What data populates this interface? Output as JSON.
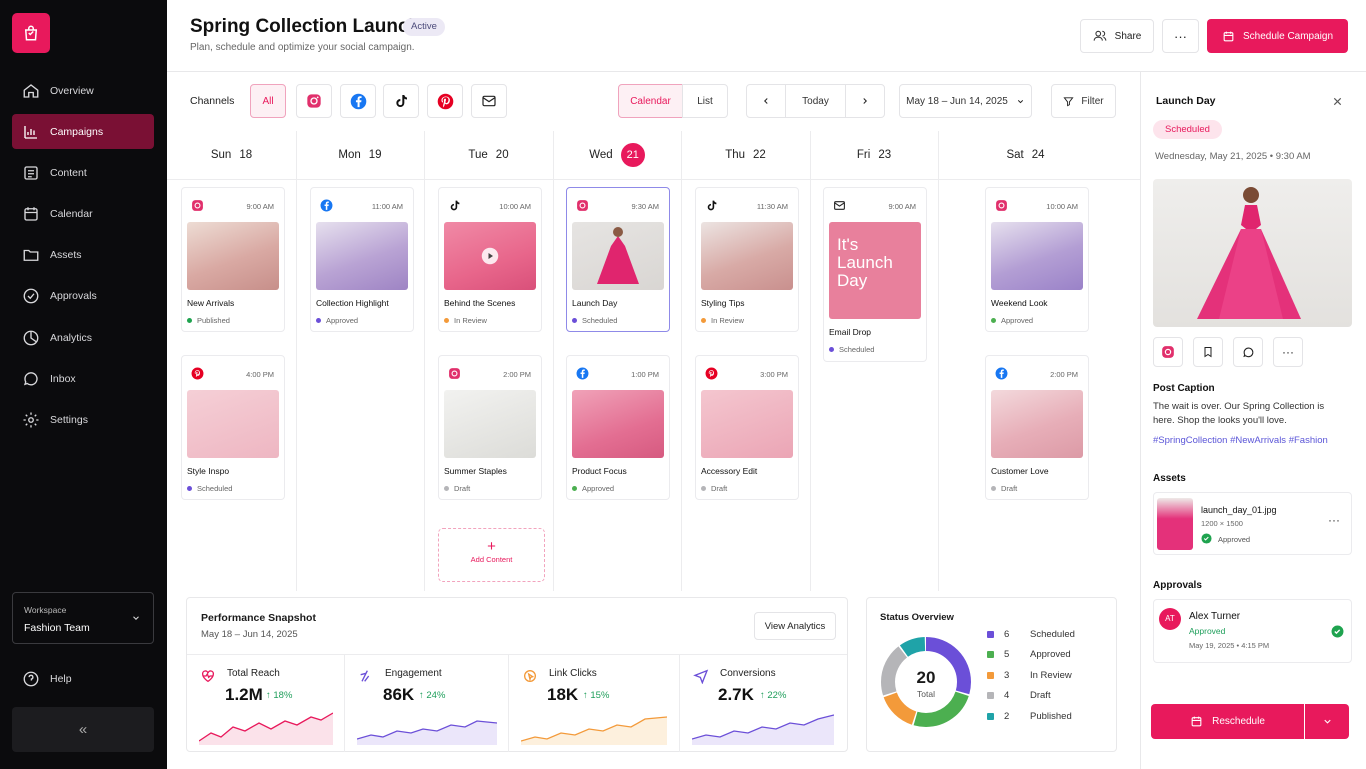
{
  "sidebar": {
    "items": [
      {
        "label": "Overview"
      },
      {
        "label": "Campaigns"
      },
      {
        "label": "Content"
      },
      {
        "label": "Calendar"
      },
      {
        "label": "Assets"
      },
      {
        "label": "Approvals"
      },
      {
        "label": "Analytics"
      },
      {
        "label": "Inbox"
      },
      {
        "label": "Settings"
      }
    ],
    "workspace_label": "Workspace",
    "workspace_name": "Fashion Team",
    "help": "Help",
    "collapse": "«"
  },
  "header": {
    "title": "Spring Collection Launch",
    "status": "Active",
    "subtitle": "Plan, schedule and optimize your social campaign.",
    "share": "Share",
    "more": "···",
    "schedule": "Schedule Campaign"
  },
  "toolbar": {
    "channels_label": "Channels",
    "all": "All",
    "calendar": "Calendar",
    "list": "List",
    "today": "Today",
    "range": "May 18 – Jun 14, 2025",
    "filter": "Filter"
  },
  "days": [
    {
      "name": "Sun",
      "num": "18"
    },
    {
      "name": "Mon",
      "num": "19"
    },
    {
      "name": "Tue",
      "num": "20"
    },
    {
      "name": "Wed",
      "num": "21"
    },
    {
      "name": "Thu",
      "num": "22"
    },
    {
      "name": "Fri",
      "num": "23"
    },
    {
      "name": "Sat",
      "num": "24"
    }
  ],
  "cards": [
    {
      "time": "9:00 AM",
      "name": "New Arrivals",
      "status": "Published"
    },
    {
      "time": "11:00 AM",
      "name": "Collection Highlight",
      "status": "Approved"
    },
    {
      "time": "10:00 AM",
      "name": "Behind the Scenes",
      "status": "In Review"
    },
    {
      "time": "9:30 AM",
      "name": "Launch Day",
      "status": "Scheduled"
    },
    {
      "time": "11:30 AM",
      "name": "Styling Tips",
      "status": "In Review"
    },
    {
      "time": "9:00 AM",
      "name": "Email Drop",
      "status": "Scheduled",
      "overlay": "It's Launch Day"
    },
    {
      "time": "10:00 AM",
      "name": "Weekend Look",
      "status": "Approved"
    },
    {
      "time": "4:00 PM",
      "name": "Style Inspo",
      "status": "Scheduled"
    },
    {
      "time": "2:00 PM",
      "name": "Summer Staples",
      "status": "Draft"
    },
    {
      "time": "1:00 PM",
      "name": "Product Focus",
      "status": "Approved"
    },
    {
      "time": "3:00 PM",
      "name": "Accessory Edit",
      "status": "Draft"
    },
    {
      "time": "2:00 PM",
      "name": "Customer Love",
      "status": "Draft"
    }
  ],
  "add_content": "Add Content",
  "performance": {
    "title": "Performance Snapshot",
    "range": "May 18 – Jun 14, 2025",
    "view": "View Analytics",
    "kpis": [
      {
        "label": "Total Reach",
        "value": "1.2M",
        "change": "↑ 18%"
      },
      {
        "label": "Engagement",
        "value": "86K",
        "change": "↑ 24%"
      },
      {
        "label": "Link Clicks",
        "value": "18K",
        "change": "↑ 15%"
      },
      {
        "label": "Conversions",
        "value": "2.7K",
        "change": "↑ 22%"
      }
    ]
  },
  "status_overview": {
    "title": "Status Overview",
    "total": "20",
    "total_label": "Total",
    "rows": [
      {
        "count": "6",
        "label": "Scheduled",
        "color": "#6b4fd8"
      },
      {
        "count": "5",
        "label": "Approved",
        "color": "#4caf50"
      },
      {
        "count": "3",
        "label": "In Review",
        "color": "#f39a3a"
      },
      {
        "count": "4",
        "label": "Draft",
        "color": "#b5b5b8"
      },
      {
        "count": "2",
        "label": "Published",
        "color": "#1fa3a8"
      }
    ]
  },
  "panel": {
    "title": "Launch Day",
    "status": "Scheduled",
    "datetime": "Wednesday, May 21, 2025  •  9:30 AM",
    "caption_title": "Post Caption",
    "caption": "The wait is over. Our Spring Collection is here. Shop the looks you'll love.",
    "hashtags": "#SpringCollection #NewArrivals #Fashion",
    "assets_title": "Assets",
    "asset_name": "launch_day_01.jpg",
    "asset_dims": "1200 × 1500",
    "asset_status": "Approved",
    "approvals_title": "Approvals",
    "approver_initials": "AT",
    "approver_name": "Alex Turner",
    "approver_status": "Approved",
    "approver_date": "May 19, 2025  •  4:15 PM",
    "reschedule": "Reschedule"
  },
  "colors": {
    "accent": "#e8195c",
    "sidebar": "#0b0b0d",
    "active_nav": "#7a1034"
  }
}
